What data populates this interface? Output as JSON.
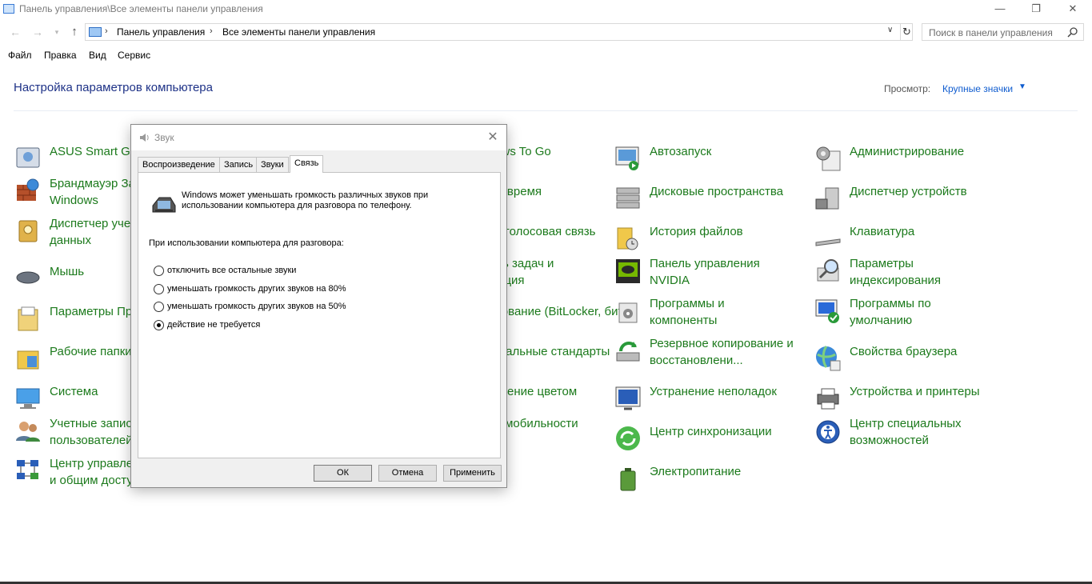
{
  "window": {
    "title": "Панель управления\\Все элементы панели управления",
    "minimize": "—",
    "maximize": "❐",
    "close": "✕"
  },
  "nav": {
    "back_icon": "←",
    "forward_icon": "→",
    "recent_icon": "▾",
    "up_icon": "↑"
  },
  "address": {
    "crumbs": [
      "Панель управления",
      "Все элементы панели управления"
    ],
    "separator": "›",
    "dropdown_icon": "∨",
    "refresh_icon": "↻"
  },
  "search": {
    "placeholder": "Поиск в панели управления"
  },
  "menu": [
    "Файл",
    "Правка",
    "Вид",
    "Сервис"
  ],
  "header": {
    "title": "Настройка параметров компьютера",
    "view_label": "Просмотр:",
    "view_value": "Крупные значки",
    "view_caret": "▼"
  },
  "columns": [
    {
      "items": [
        {
          "label": "ASUS Smart Gesture",
          "icon": "touchpad-icon"
        },
        {
          "label": "Брандмауэр Защитника\nWindows",
          "icon": "firewall-icon"
        },
        {
          "label": "Диспетчер учетных\nданных",
          "icon": "credentials-icon"
        },
        {
          "label": "Мышь",
          "icon": "mouse-icon"
        },
        {
          "label": "Параметры Проводника",
          "icon": "folder-options-icon"
        },
        {
          "label": "Рабочие папки",
          "icon": "work-folders-icon"
        },
        {
          "label": "Система",
          "icon": "system-icon"
        },
        {
          "label": "Учетные записи\nпользователей",
          "icon": "users-icon"
        },
        {
          "label": "Центр управления сетями\nи общим доступом",
          "icon": "network-icon"
        }
      ]
    },
    {
      "items": [
        {
          "label": "Windows To Go",
          "icon": "usb-icon"
        },
        {
          "label": "Дата и время",
          "icon": "clock-icon"
        },
        {
          "label": "Звук и голосовая связь",
          "icon": "sound-icon"
        },
        {
          "label": "Панель задач и\nнавигация",
          "icon": "taskbar-icon"
        },
        {
          "label": "Шифрование (BitLocker, бита)",
          "icon": "bitlocker-icon"
        },
        {
          "label": "Региональные стандарты",
          "icon": "region-icon"
        },
        {
          "label": "Управление цветом",
          "icon": "color-icon"
        },
        {
          "label": "Центр мобильности",
          "icon": "mobility-icon"
        }
      ]
    },
    {
      "items": [
        {
          "label": "Автозапуск",
          "icon": "autoplay-icon"
        },
        {
          "label": "Дисковые пространства",
          "icon": "storage-spaces-icon"
        },
        {
          "label": "История файлов",
          "icon": "file-history-icon"
        },
        {
          "label": "Панель управления\nNVIDIA",
          "icon": "nvidia-icon"
        },
        {
          "label": "Программы и\nкомпоненты",
          "icon": "programs-icon"
        },
        {
          "label": "Резервное копирование и\nвосстановлени...",
          "icon": "backup-icon"
        },
        {
          "label": "Устранение неполадок",
          "icon": "troubleshoot-icon"
        },
        {
          "label": "Центр синхронизации",
          "icon": "sync-icon"
        },
        {
          "label": "Электропитание",
          "icon": "power-icon"
        }
      ]
    },
    {
      "items": [
        {
          "label": "Администрирование",
          "icon": "admin-tools-icon"
        },
        {
          "label": "Диспетчер устройств",
          "icon": "device-manager-icon"
        },
        {
          "label": "Клавиатура",
          "icon": "keyboard-icon"
        },
        {
          "label": "Параметры\nиндексирования",
          "icon": "indexing-icon"
        },
        {
          "label": "Программы по\nумолчанию",
          "icon": "default-programs-icon"
        },
        {
          "label": "Свойства браузера",
          "icon": "internet-options-icon"
        },
        {
          "label": "Устройства и принтеры",
          "icon": "printers-icon"
        },
        {
          "label": "Центр специальных\nвозможностей",
          "icon": "accessibility-icon"
        }
      ]
    }
  ],
  "dialog": {
    "title": "Звук",
    "close": "✕",
    "tabs": [
      "Воспроизведение",
      "Запись",
      "Звуки",
      "Связь"
    ],
    "active_tab": "Связь",
    "info_text": "Windows может уменьшать громкость различных звуков при\nиспользовании компьютера для разговора по телефону.",
    "section_label": "При использовании компьютера для разговора:",
    "options": [
      {
        "label": "отключить все остальные звуки",
        "selected": false
      },
      {
        "label": "уменьшать громкость других звуков на 80%",
        "selected": false
      },
      {
        "label": "уменьшать громкость других звуков на 50%",
        "selected": false
      },
      {
        "label": "действие не требуется",
        "selected": true
      }
    ],
    "buttons": {
      "ok": "ОК",
      "cancel": "Отмена",
      "apply": "Применить"
    }
  }
}
